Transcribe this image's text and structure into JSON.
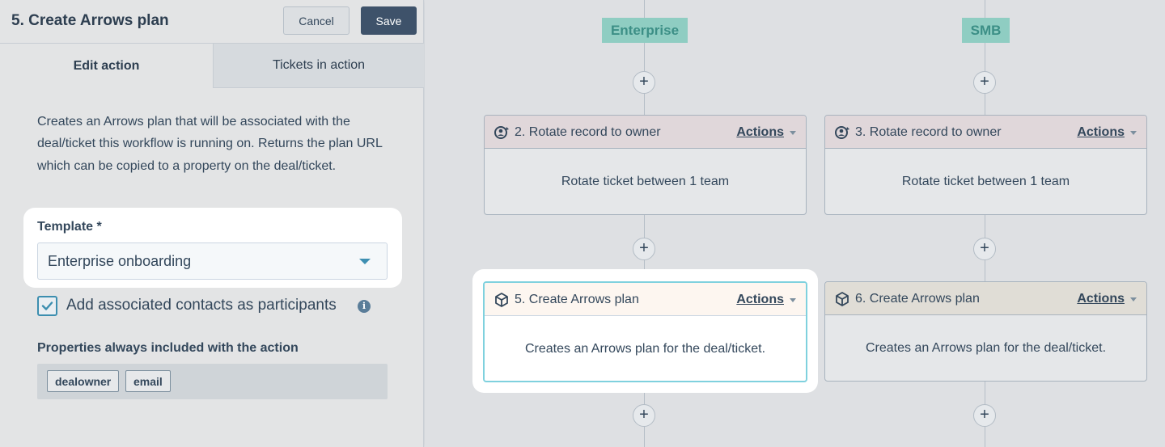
{
  "panel": {
    "title": "5. Create Arrows plan",
    "cancel_label": "Cancel",
    "save_label": "Save",
    "tabs": [
      {
        "label": "Edit action",
        "active": true
      },
      {
        "label": "Tickets in action",
        "active": false
      }
    ],
    "description": "Creates an Arrows plan that will be associated with the deal/ticket this workflow is running on. Returns the plan URL which can be copied to a property on the deal/ticket.",
    "template": {
      "label": "Template *",
      "value": "Enterprise onboarding"
    },
    "participants": {
      "label": "Add associated contacts as participants",
      "checked": true
    },
    "properties": {
      "label": "Properties always included with the action",
      "chips": [
        "dealowner",
        "email"
      ]
    }
  },
  "canvas": {
    "branches": [
      {
        "label": "Enterprise"
      },
      {
        "label": "SMB"
      }
    ],
    "plus_symbol": "+",
    "cards": [
      {
        "title": "2. Rotate record to owner",
        "actions": "Actions",
        "body": "Rotate ticket between 1 team",
        "icon": "rotate-owner-icon"
      },
      {
        "title": "3. Rotate record to owner",
        "actions": "Actions",
        "body": "Rotate ticket between 1 team",
        "icon": "rotate-owner-icon"
      },
      {
        "title": "5. Create Arrows plan",
        "actions": "Actions",
        "body": "Creates an Arrows plan for the deal/ticket.",
        "icon": "cube-icon",
        "selected": true
      },
      {
        "title": "6. Create Arrows plan",
        "actions": "Actions",
        "body": "Creates an Arrows plan for the deal/ticket.",
        "icon": "cube-icon"
      }
    ]
  },
  "colors": {
    "save_button": "#3e526a",
    "branch_label_bg": "#8fcdc2",
    "branch_label_text": "#3c8f86",
    "selected_card_border": "#7fd1de",
    "checkbox_accent": "#3c8eaf"
  }
}
